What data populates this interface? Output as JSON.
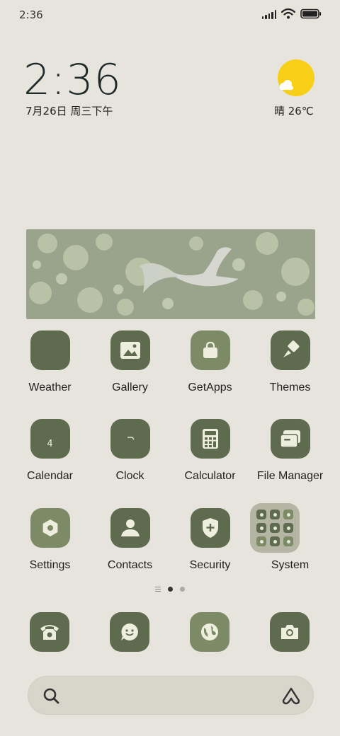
{
  "status_bar": {
    "time": "2:36",
    "icons": [
      "signal-icon",
      "wifi-icon",
      "battery-icon"
    ]
  },
  "clock_widget": {
    "time": "2:36",
    "date": "7月26日 周三下午"
  },
  "weather_widget": {
    "text": "晴 26℃",
    "icon": "sun-cloud-icon"
  },
  "photo_widget": {
    "subject": "seagull-photo"
  },
  "apps": [
    {
      "label": "Weather",
      "icon": "weather-icon"
    },
    {
      "label": "Gallery",
      "icon": "gallery-icon"
    },
    {
      "label": "GetApps",
      "icon": "shopping-bag-icon"
    },
    {
      "label": "Themes",
      "icon": "paintbrush-icon"
    },
    {
      "label": "Calendar",
      "icon": "calendar-icon",
      "icon_text": "4"
    },
    {
      "label": "Clock",
      "icon": "clock-icon"
    },
    {
      "label": "Calculator",
      "icon": "calculator-icon"
    },
    {
      "label": "File Manager",
      "icon": "folder-icon"
    },
    {
      "label": "Settings",
      "icon": "settings-icon"
    },
    {
      "label": "Contacts",
      "icon": "contacts-icon"
    },
    {
      "label": "Security",
      "icon": "security-shield-icon"
    },
    {
      "label": "System",
      "icon": "system-folder-icon"
    }
  ],
  "page_indicator": {
    "pages": 2,
    "active": 1
  },
  "dock": [
    {
      "icon": "phone-icon"
    },
    {
      "icon": "messages-icon"
    },
    {
      "icon": "browser-icon"
    },
    {
      "icon": "camera-icon"
    }
  ],
  "search_bar": {
    "icons": [
      "search-icon",
      "assistant-icon"
    ]
  },
  "colors": {
    "background": "#e7e4dd",
    "icon_dark": "#5e6b4e",
    "icon_light": "#7c8a66",
    "sun": "#f7cf17"
  }
}
